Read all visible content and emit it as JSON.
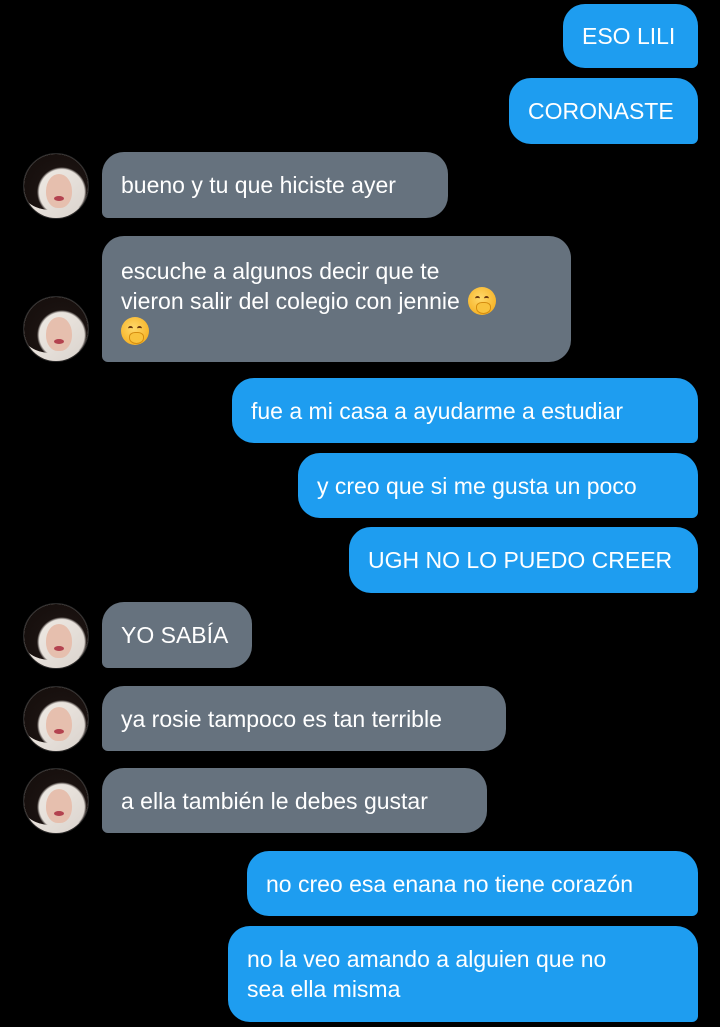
{
  "chat": {
    "messages": [
      {
        "side": "sent",
        "text": "ESO LILI"
      },
      {
        "side": "sent",
        "text": "CORONASTE"
      },
      {
        "side": "recv",
        "text": "bueno y tu que hiciste ayer"
      },
      {
        "side": "recv",
        "line1": "escuche a algunos decir que te",
        "line2": "vieron salir del colegio con jennie",
        "emoji": "shushing-face-emoji"
      },
      {
        "side": "sent",
        "text": "fue a mi casa a ayudarme a estudiar"
      },
      {
        "side": "sent",
        "text": "y creo que si me gusta un poco"
      },
      {
        "side": "sent",
        "text": "UGH NO LO PUEDO CREER"
      },
      {
        "side": "recv",
        "text": "YO SABÍA"
      },
      {
        "side": "recv",
        "text": "ya rosie tampoco es tan terrible"
      },
      {
        "side": "recv",
        "text": "a ella también le debes gustar"
      },
      {
        "side": "sent",
        "text": "no creo esa enana no tiene corazón"
      },
      {
        "side": "sent",
        "line1": "no la veo amando a alguien que no",
        "line2": "sea ella misma"
      }
    ]
  },
  "colors": {
    "background": "#000000",
    "sent_bubble": "#1e9df0",
    "received_bubble": "#66727e",
    "text": "#ffffff"
  }
}
